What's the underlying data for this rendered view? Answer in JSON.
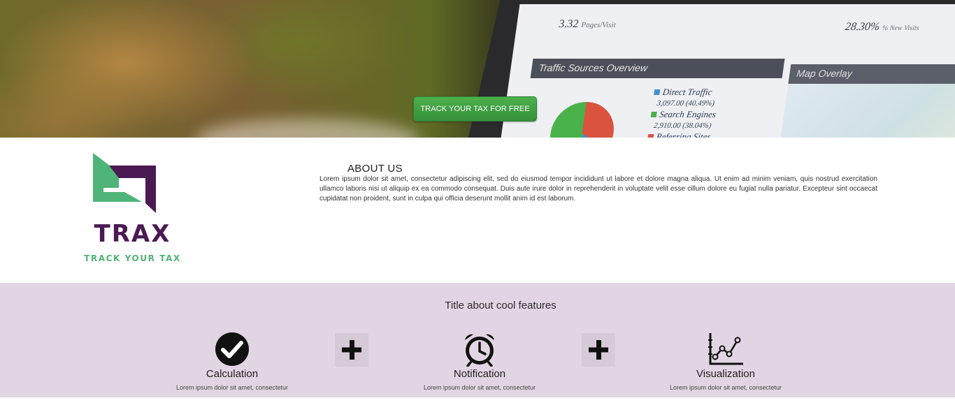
{
  "hero": {
    "cta_label": "TRACK YOUR TAX FOR FREE",
    "screen": {
      "stat1_value": "3.32",
      "stat1_label": "Pages/Visit",
      "stat2_value": "28.30%",
      "stat2_label": "% New Visits",
      "panel1_title": "Traffic Sources Overview",
      "panel2_title": "Map Overlay",
      "legend": [
        {
          "name": "Direct Traffic",
          "value": "3,097.00 (40.49%)",
          "color": "#3f8fd6"
        },
        {
          "name": "Search Engines",
          "value": "2,910.00 (38.04%)",
          "color": "#49b24b"
        },
        {
          "name": "Referring Sites",
          "value": "",
          "color": "#d9533f"
        }
      ]
    }
  },
  "brand": {
    "name": "TRAX",
    "tagline": "TRACK YOUR TAX",
    "primary_color": "#4b1a53",
    "accent_color": "#4fb477"
  },
  "about": {
    "title": "ABOUT US",
    "text": "Lorem ipsum dolor sit amet, consectetur adipiscing elit, sed do eiusmod tempor incididunt ut labore et dolore magna aliqua. Ut enim ad minim veniam, quis nostrud exercitation ullamco laboris nisi ut aliquip ex ea commodo consequat. Duis aute irure dolor in reprehenderit in voluptate velit esse cillum dolore eu fugiat nulla pariatur. Excepteur sint occaecat cupidatat non proident, sunt in culpa qui officia deserunt mollit anim id est laborum."
  },
  "features": {
    "title": "Title about cool features",
    "background": "#e2d5e3",
    "items": [
      {
        "icon": "check-circle-icon",
        "label": "Calculation",
        "desc": "Lorem ipsum dolor sit amet, consectetur"
      },
      {
        "icon": "alarm-clock-icon",
        "label": "Notification",
        "desc": "Lorem ipsum dolor sit amet, consectetur"
      },
      {
        "icon": "line-chart-icon",
        "label": "Visualization",
        "desc": "Lorem ipsum dolor sit amet, consectetur"
      }
    ],
    "separator_icon": "plus-icon"
  }
}
